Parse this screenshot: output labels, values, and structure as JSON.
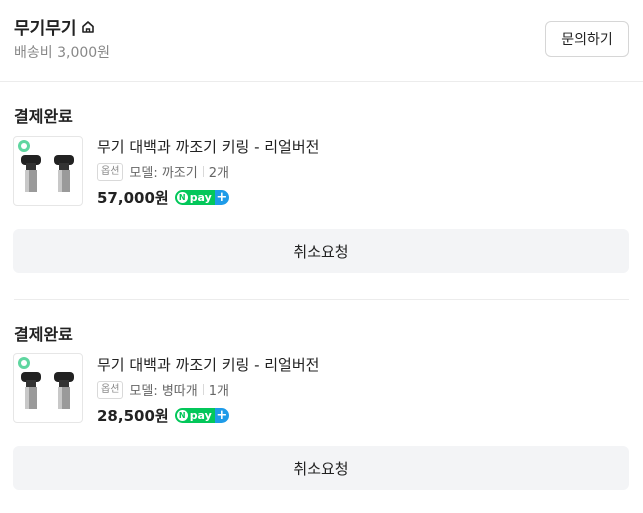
{
  "store": {
    "name": "무기무기",
    "shipping": "배송비 3,000원",
    "inquiry_label": "문의하기"
  },
  "orders": [
    {
      "status": "결제완료",
      "product_name": "무기 대백과 까조기 키링 - 리얼버전",
      "option_badge": "옵션",
      "option_text": "모델: 까조기",
      "quantity": "2개",
      "price": "57,000원",
      "pay_badge": "pay",
      "cancel_label": "취소요청"
    },
    {
      "status": "결제완료",
      "product_name": "무기 대백과 까조기 키링 - 리얼버전",
      "option_badge": "옵션",
      "option_text": "모델: 병따개",
      "quantity": "1개",
      "price": "28,500원",
      "pay_badge": "pay",
      "cancel_label": "취소요청"
    }
  ],
  "colors": {
    "npay_green": "#03c75a",
    "npay_blue": "#1e9be8",
    "button_bg": "#f3f4f6"
  }
}
